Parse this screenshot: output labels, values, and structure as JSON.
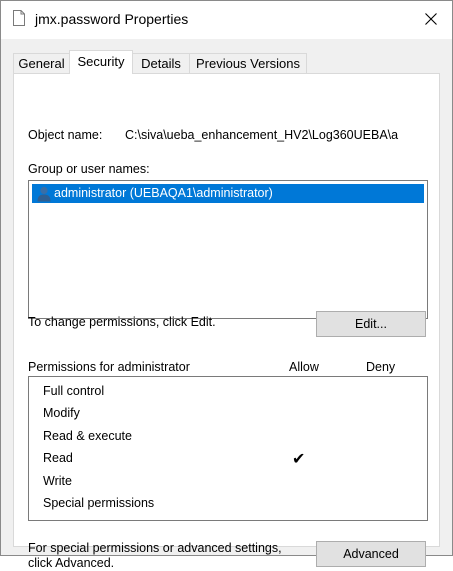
{
  "window": {
    "title": "jmx.password Properties"
  },
  "tabs": [
    {
      "label": "General"
    },
    {
      "label": "Security"
    },
    {
      "label": "Details"
    },
    {
      "label": "Previous Versions"
    }
  ],
  "security": {
    "object_name_label": "Object name:",
    "object_name_value": "C:\\siva\\ueba_enhancement_HV2\\Log360UEBA\\a",
    "group_label": "Group or user names:",
    "users": [
      {
        "name": "administrator (UEBAQA1\\administrator)",
        "selected": true
      }
    ],
    "change_text": "To change permissions, click Edit.",
    "edit_button": "Edit...",
    "permissions_label": "Permissions for administrator",
    "allow_header": "Allow",
    "deny_header": "Deny",
    "permissions": [
      {
        "name": "Full control",
        "allow": false,
        "deny": false
      },
      {
        "name": "Modify",
        "allow": false,
        "deny": false
      },
      {
        "name": "Read & execute",
        "allow": false,
        "deny": false
      },
      {
        "name": "Read",
        "allow": true,
        "deny": false
      },
      {
        "name": "Write",
        "allow": false,
        "deny": false
      },
      {
        "name": "Special permissions",
        "allow": false,
        "deny": false
      }
    ],
    "check_glyph": "✔",
    "advanced_text_line1": "For special permissions or advanced settings,",
    "advanced_text_line2": "click Advanced.",
    "advanced_button": "Advanced"
  },
  "colors": {
    "selection": "#0078d7",
    "dialog_bg": "#f0f0f0",
    "button_bg": "#e1e1e1"
  }
}
